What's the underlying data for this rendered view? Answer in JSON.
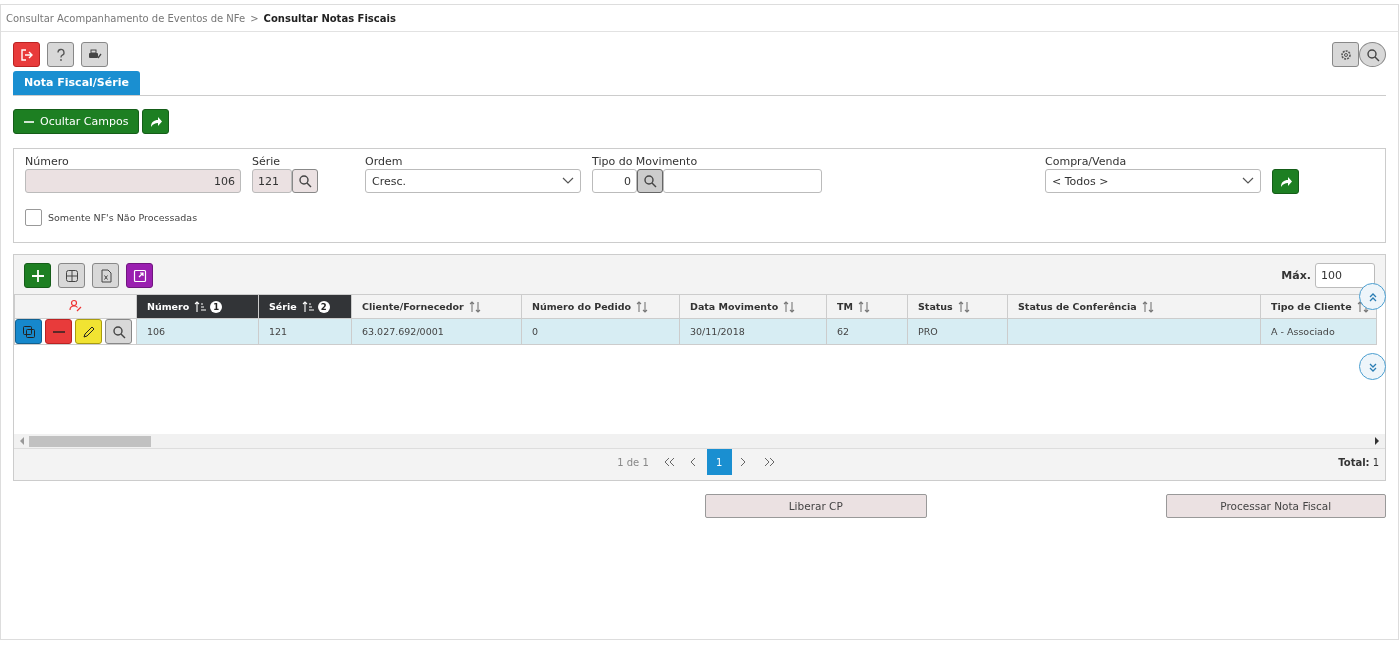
{
  "breadcrumb_separator": ">",
  "breadcrumb": [
    {
      "label": "Consultar Acompanhamento de Eventos de NFe",
      "current": false
    },
    {
      "label": "Consultar Notas Fiscais",
      "current": true
    }
  ],
  "tabs": [
    {
      "label": "Nota Fiscal/Série",
      "selected": true
    }
  ],
  "hide_fields_button": "Ocultar Campos",
  "filters": [
    {
      "kind": "text",
      "label": "Número",
      "value": "106"
    },
    {
      "kind": "lookup",
      "label": "Série",
      "value": "121"
    },
    {
      "kind": "select",
      "label": "Ordem",
      "value": "Cresc."
    },
    {
      "kind": "lookup_desc",
      "label": "Tipo do Movimento",
      "value": "0"
    },
    {
      "kind": "select",
      "label": "Compra/Venda",
      "value": "< Todos >"
    }
  ],
  "checkbox": {
    "label": "Somente NF's Não Processadas",
    "checked": false
  },
  "grid": {
    "max_label": "Máx.",
    "max_value": "100",
    "columns": [
      {
        "label": "Número",
        "sorted": true,
        "sort_order": "1"
      },
      {
        "label": "Série",
        "sorted": true,
        "sort_order": "2"
      },
      {
        "label": "Cliente/Fornecedor",
        "sorted": false
      },
      {
        "label": "Número do Pedido",
        "sorted": false
      },
      {
        "label": "Data Movimento",
        "sorted": false
      },
      {
        "label": "TM",
        "sorted": false
      },
      {
        "label": "Status",
        "sorted": false
      },
      {
        "label": "Status de Conferência",
        "sorted": false
      },
      {
        "label": "Tipo de Cliente",
        "sorted": false
      }
    ],
    "rows": [
      {
        "selected": true,
        "cells": [
          "106",
          "121",
          "63.027.692/0001",
          "0",
          "30/11/2018",
          "62",
          "PRO",
          "",
          "A - Associado"
        ]
      }
    ]
  },
  "pagination": {
    "info": "1 de 1",
    "pages": [
      {
        "label": "1",
        "selected": true
      }
    ],
    "total_label": "Total:",
    "total": "1"
  },
  "buttons": [
    "Liberar CP",
    "Processar Nota Fiscal"
  ]
}
